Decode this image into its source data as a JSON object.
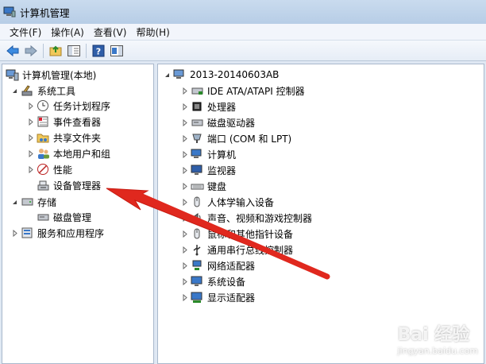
{
  "window": {
    "title": "计算机管理"
  },
  "menu": [
    {
      "label": "文件(F)"
    },
    {
      "label": "操作(A)"
    },
    {
      "label": "查看(V)"
    },
    {
      "label": "帮助(H)"
    }
  ],
  "toolbar": {
    "buttons": [
      "back-icon",
      "forward-icon",
      "up-folder-icon",
      "show-hide-tree-icon",
      "help-icon",
      "properties-pane-icon"
    ]
  },
  "tree": {
    "root": "计算机管理(本地)",
    "system_tools": "系统工具",
    "task_scheduler": "任务计划程序",
    "event_viewer": "事件查看器",
    "shared_folders": "共享文件夹",
    "local_users": "本地用户和组",
    "performance": "性能",
    "device_manager": "设备管理器",
    "storage": "存储",
    "disk_management": "磁盘管理",
    "services_apps": "服务和应用程序"
  },
  "devices": {
    "computer_name": "2013-20140603AB",
    "items": [
      {
        "label": "IDE ATA/ATAPI 控制器",
        "icon": "ide-controller-icon"
      },
      {
        "label": "处理器",
        "icon": "processor-icon"
      },
      {
        "label": "磁盘驱动器",
        "icon": "disk-drive-icon"
      },
      {
        "label": "端口 (COM 和 LPT)",
        "icon": "port-icon"
      },
      {
        "label": "计算机",
        "icon": "computer-icon"
      },
      {
        "label": "监视器",
        "icon": "monitor-icon"
      },
      {
        "label": "键盘",
        "icon": "keyboard-icon"
      },
      {
        "label": "人体学输入设备",
        "icon": "hid-icon"
      },
      {
        "label": "声音、视频和游戏控制器",
        "icon": "sound-icon"
      },
      {
        "label": "鼠标和其他指针设备",
        "icon": "mouse-icon"
      },
      {
        "label": "通用串行总线控制器",
        "icon": "usb-icon"
      },
      {
        "label": "网络适配器",
        "icon": "network-adapter-icon"
      },
      {
        "label": "系统设备",
        "icon": "system-device-icon"
      },
      {
        "label": "显示适配器",
        "icon": "display-adapter-icon"
      }
    ]
  },
  "watermark": {
    "text": "Bai 经验",
    "sub": "jingyan.baidu.com"
  },
  "colors": {
    "arrow": "#e0281e",
    "accent": "#3a78c8"
  }
}
